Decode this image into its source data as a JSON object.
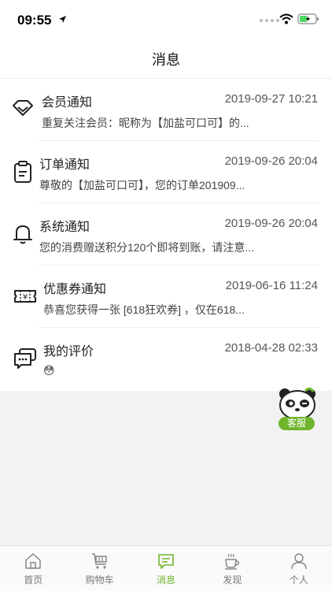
{
  "status_bar": {
    "time": "09:55"
  },
  "header": {
    "title": "消息"
  },
  "messages": [
    {
      "title": "会员通知",
      "time": "2019-09-27 10:21",
      "preview": "重复关注会员：昵称为【加盐可口可】的...",
      "icon": "diamond-icon"
    },
    {
      "title": "订单通知",
      "time": "2019-09-26 20:04",
      "preview": "尊敬的【加盐可口可】，您的订单201909...",
      "icon": "clipboard-icon"
    },
    {
      "title": "系统通知",
      "time": "2019-09-26 20:04",
      "preview": "您的消费赠送积分120个即将到账，请注意...",
      "icon": "bell-icon"
    },
    {
      "title": "优惠券通知",
      "time": "2019-06-16 11:24",
      "preview": "恭喜您获得一张 [618狂欢券] ，仅在618...",
      "icon": "coupon-icon"
    },
    {
      "title": "我的评价",
      "time": "2018-04-28 02:33",
      "preview": "😳",
      "icon": "chat-bubbles-icon"
    }
  ],
  "service": {
    "label": "客服",
    "icon": "panda-icon"
  },
  "tabs": [
    {
      "label": "首页",
      "icon": "home-icon",
      "active": false
    },
    {
      "label": "购物车",
      "icon": "cart-icon",
      "active": false
    },
    {
      "label": "消息",
      "icon": "message-icon",
      "active": true
    },
    {
      "label": "发现",
      "icon": "coffee-cup-icon",
      "active": false
    },
    {
      "label": "个人",
      "icon": "person-icon",
      "active": false
    }
  ],
  "colors": {
    "accent": "#6fb52c",
    "background": "#f2f2f2"
  }
}
